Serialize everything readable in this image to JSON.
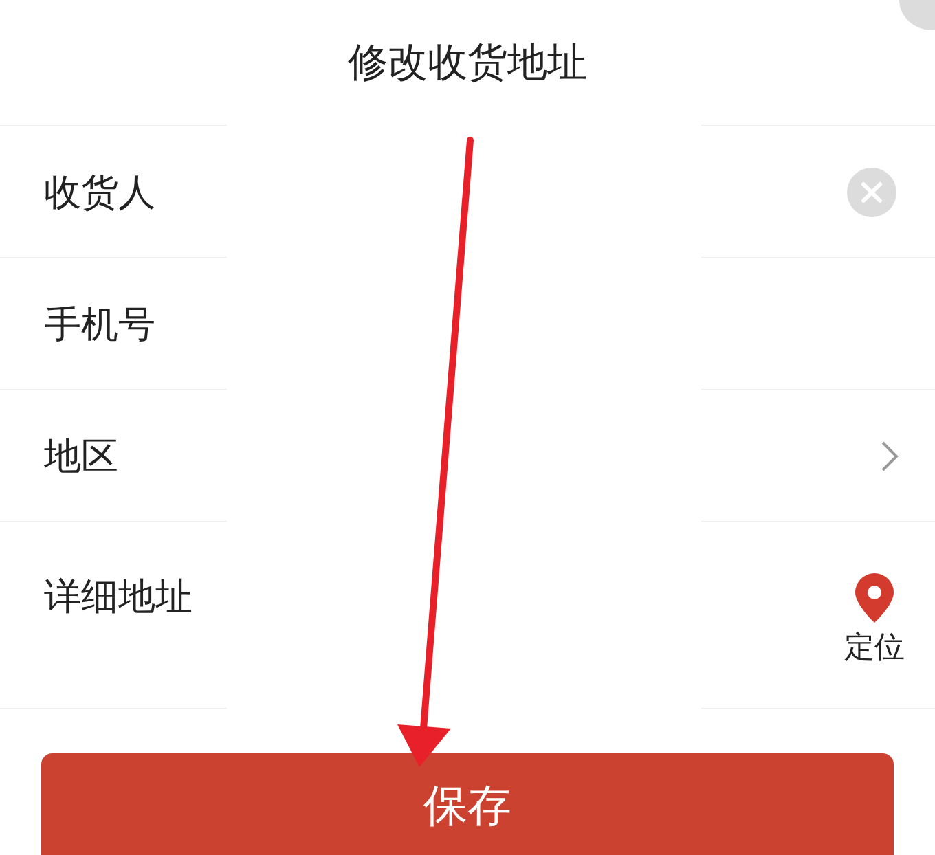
{
  "header": {
    "title": "修改收货地址"
  },
  "fields": [
    {
      "label": "收货人",
      "kind": "clear"
    },
    {
      "label": "手机号",
      "kind": "plain"
    },
    {
      "label": "地区",
      "kind": "chevron"
    },
    {
      "label": "详细地址",
      "kind": "locate",
      "action": "定位"
    }
  ],
  "save_button": "保存"
}
